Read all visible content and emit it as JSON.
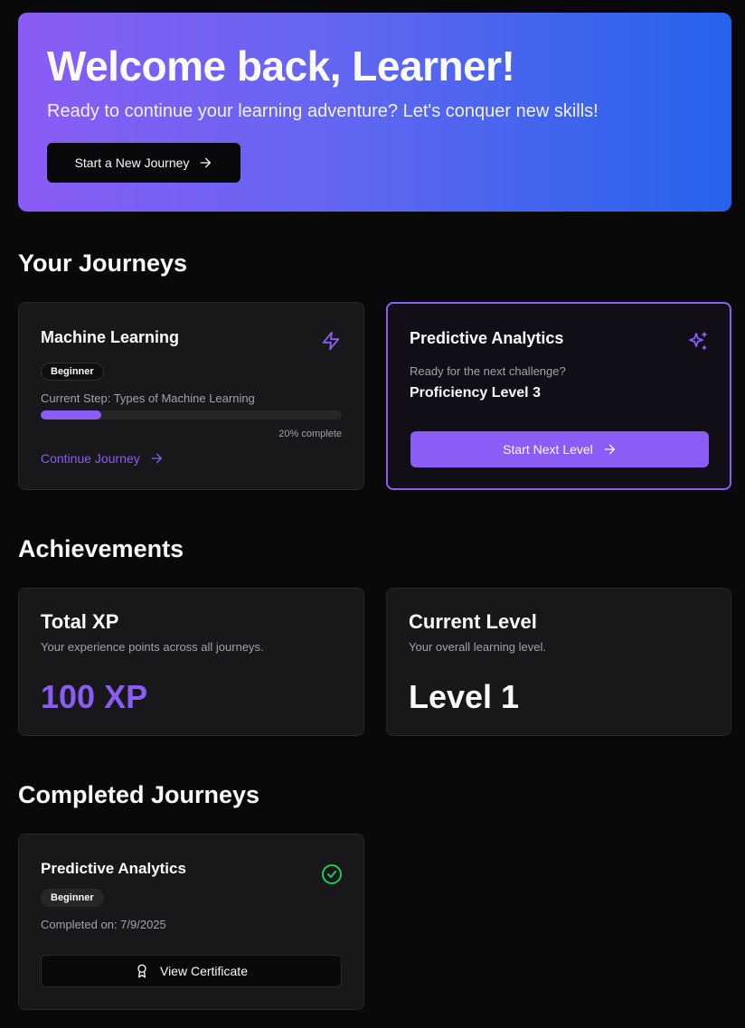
{
  "hero": {
    "title": "Welcome back, Learner!",
    "subtitle": "Ready to continue your learning adventure? Let's conquer new skills!",
    "button_label": "Start a New Journey"
  },
  "sections": {
    "journeys": "Your Journeys",
    "achievements": "Achievements",
    "completed": "Completed Journeys"
  },
  "journey_card": {
    "title": "Machine Learning",
    "badge": "Beginner",
    "current_step": "Current Step: Types of Machine Learning",
    "progress_percent": 20,
    "progress_text": "20% complete",
    "continue_label": "Continue Journey"
  },
  "next_card": {
    "title": "Predictive Analytics",
    "prompt": "Ready for the next challenge?",
    "level": "Proficiency Level 3",
    "button_label": "Start Next Level"
  },
  "achievements": {
    "xp_title": "Total XP",
    "xp_desc": "Your experience points across all journeys.",
    "xp_value": "100 XP",
    "level_title": "Current Level",
    "level_desc": "Your overall learning level.",
    "level_value": "Level 1"
  },
  "completed_card": {
    "title": "Predictive Analytics",
    "badge": "Beginner",
    "completed_on": "Completed on: 7/9/2025",
    "button_label": "View Certificate"
  },
  "colors": {
    "accent": "#8b5cf6",
    "success": "#22c55e",
    "hero_gradient_start": "#8b5cf6",
    "hero_gradient_end": "#2563eb"
  }
}
